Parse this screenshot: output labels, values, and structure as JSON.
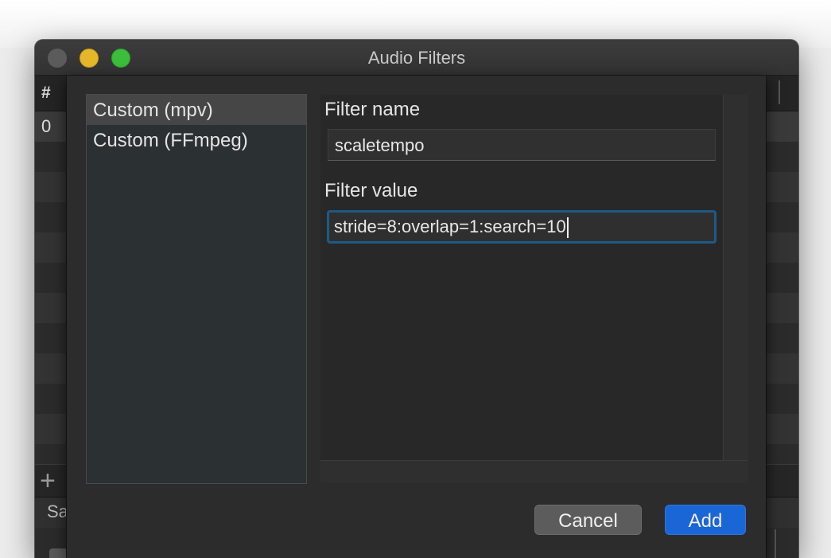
{
  "window": {
    "title": "Audio Filters"
  },
  "background_table": {
    "header_label": "#",
    "first_row_value": "0",
    "saved_section_label": "Sa"
  },
  "dialog": {
    "filter_types": [
      {
        "label": "Custom (mpv)",
        "selected": true
      },
      {
        "label": "Custom (FFmpeg)",
        "selected": false
      }
    ],
    "filter_name_label": "Filter name",
    "filter_name_value": "scaletempo",
    "filter_value_label": "Filter value",
    "filter_value_value": "stride=8:overlap=1:search=10",
    "cancel_label": "Cancel",
    "add_label": "Add"
  },
  "colors": {
    "accent_blue": "#1b66d6",
    "focus_ring": "#1d5a86",
    "window_bg": "#2b2b2b",
    "traffic_yellow": "#e6b829",
    "traffic_green": "#3cbd3b"
  }
}
